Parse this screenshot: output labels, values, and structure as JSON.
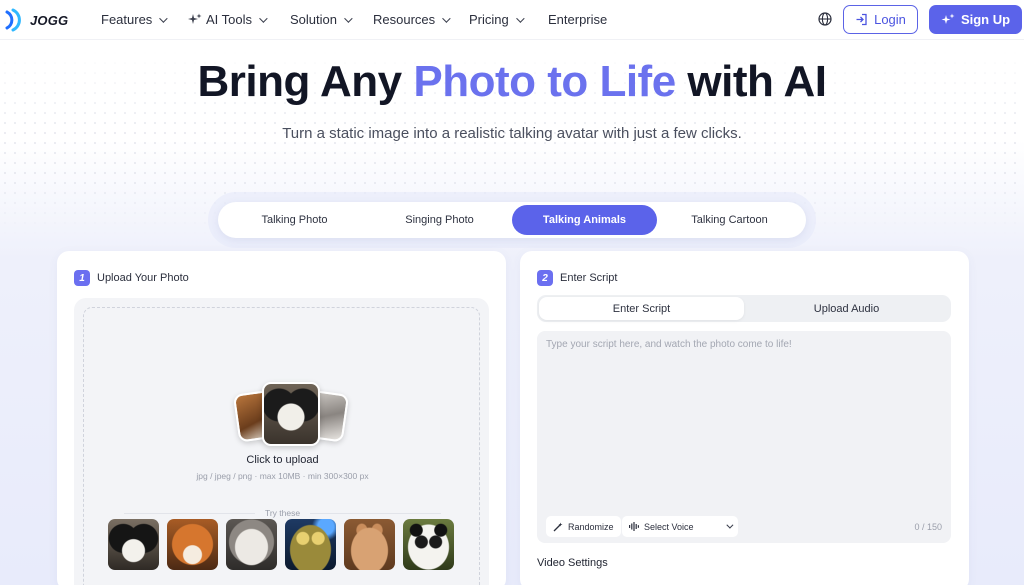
{
  "brand": {
    "name": "JOGG"
  },
  "nav": {
    "items": [
      {
        "label": "Features",
        "has_dropdown": true
      },
      {
        "label": "AI Tools",
        "has_dropdown": true,
        "icon": "sparkle-icon"
      },
      {
        "label": "Solution",
        "has_dropdown": true
      },
      {
        "label": "Resources",
        "has_dropdown": true
      },
      {
        "label": "Pricing",
        "has_dropdown": true
      },
      {
        "label": "Enterprise",
        "has_dropdown": false
      }
    ],
    "globe_icon": "globe-icon",
    "login_label": "Login",
    "signup_label": "Sign Up"
  },
  "hero": {
    "title_pre": "Bring Any ",
    "title_accent": "Photo to Life",
    "title_post": " with AI",
    "subtitle": "Turn a static image into a realistic talking avatar with just a few clicks."
  },
  "tabs": [
    {
      "label": "Talking Photo",
      "active": false
    },
    {
      "label": "Singing Photo",
      "active": false
    },
    {
      "label": "Talking Animals",
      "active": true
    },
    {
      "label": "Talking Cartoon",
      "active": false
    }
  ],
  "upload_panel": {
    "step_number": "1",
    "step_title": "Upload Your Photo",
    "click_label": "Click to upload",
    "hint": "jpg / jpeg / png · max 10MB · min 300×300 px",
    "try_label": "Try these",
    "samples": [
      "dog",
      "fox",
      "cat",
      "frog",
      "rabbit",
      "panda"
    ]
  },
  "script_panel": {
    "step_number": "2",
    "step_title": "Enter Script",
    "modes": [
      {
        "label": "Enter Script",
        "active": true
      },
      {
        "label": "Upload Audio",
        "active": false
      }
    ],
    "placeholder": "Type your script here, and watch the photo come to life!",
    "randomize_label": "Randomize",
    "voice_label": "Select Voice",
    "counter": "0 / 150",
    "video_settings_label": "Video Settings"
  },
  "colors": {
    "accent": "#5b63ea",
    "accent_text": "#6b72ee"
  }
}
